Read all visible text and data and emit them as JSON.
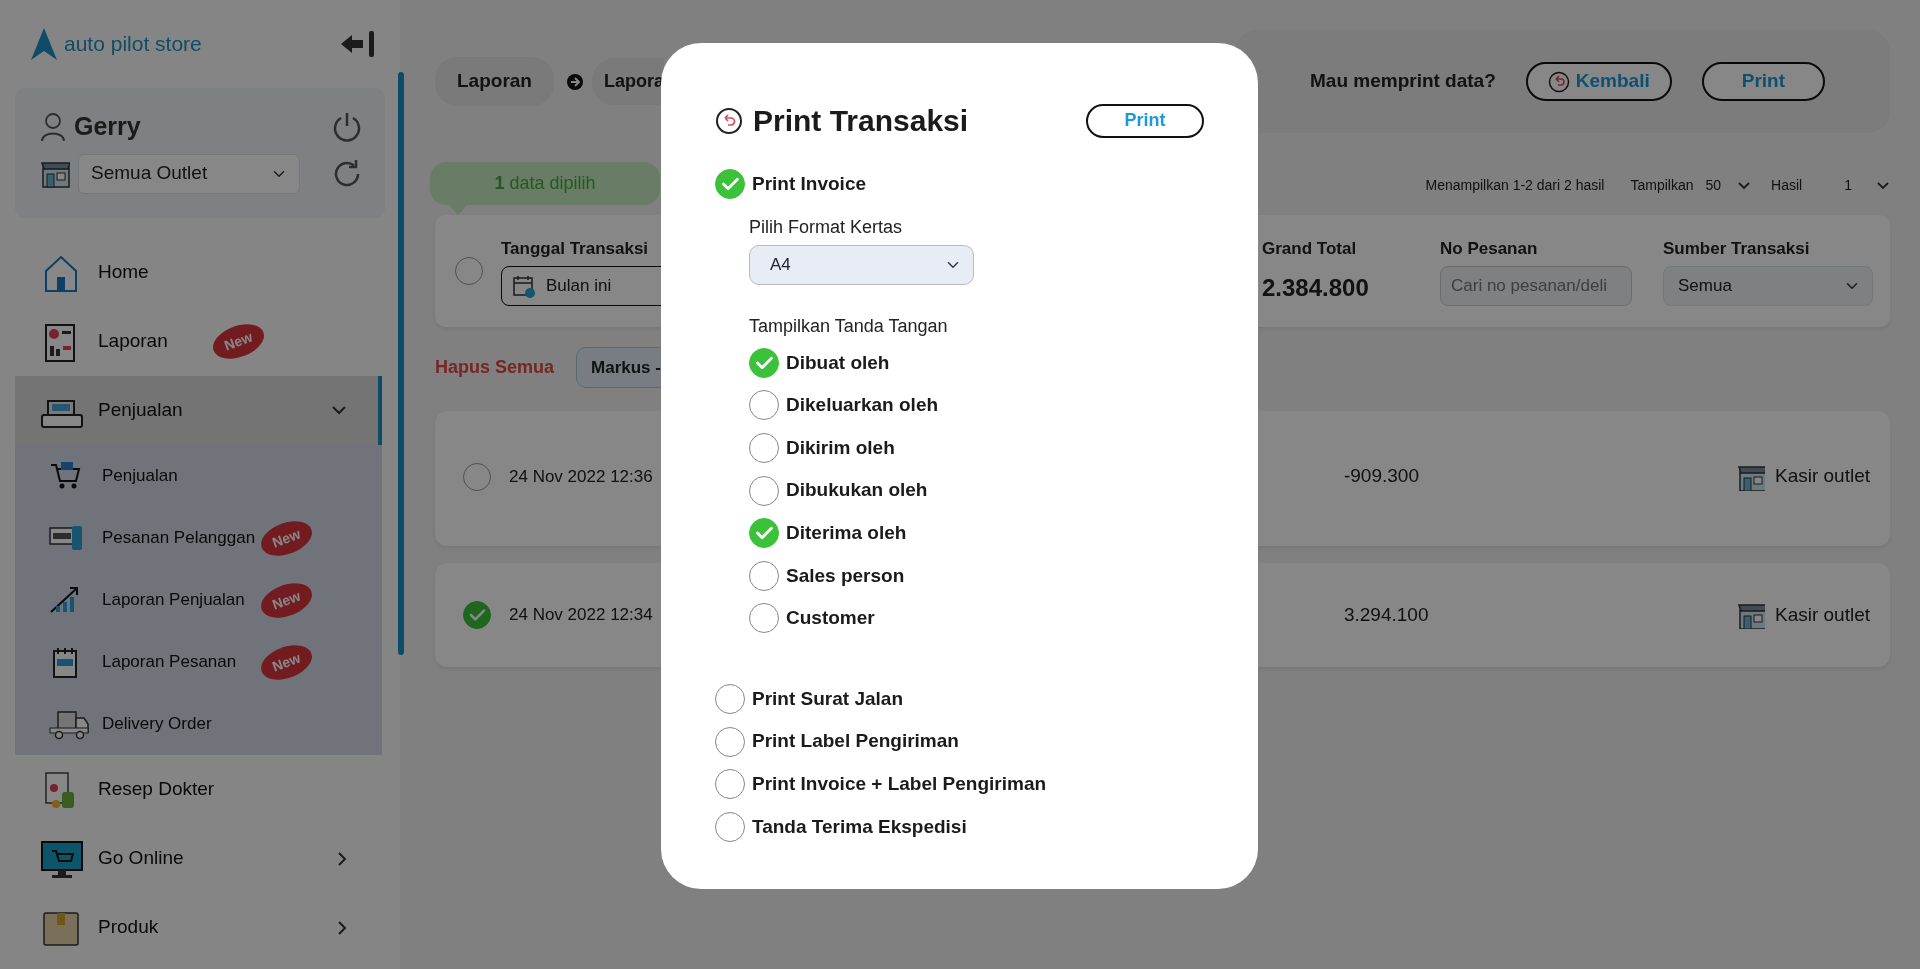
{
  "sidebar": {
    "logo": "auto pilot store",
    "user": {
      "name": "Gerry"
    },
    "outlet_select": {
      "value": "Semua Outlet"
    },
    "menu": [
      {
        "label": "Home",
        "selected": false
      },
      {
        "label": "Laporan",
        "badge": "New",
        "selected": false
      },
      {
        "label": "Penjualan",
        "selected": true,
        "expanded": true,
        "children": [
          {
            "label": "Penjualan"
          },
          {
            "label": "Pesanan Pelanggan",
            "badge": "New"
          },
          {
            "label": "Laporan Penjualan",
            "badge": "New"
          },
          {
            "label": "Laporan Pesanan",
            "badge": "New"
          },
          {
            "label": "Delivery Order"
          }
        ]
      },
      {
        "label": "Resep Dokter",
        "selected": false
      },
      {
        "label": "Go Online",
        "selected": false,
        "expanded": false
      },
      {
        "label": "Produk",
        "selected": false,
        "expanded": false
      }
    ]
  },
  "breadcrumb": [
    "Laporan",
    "Lapora"
  ],
  "confirm_bar": {
    "question": "Mau memprint data?",
    "buttons": [
      {
        "label": "Kembali",
        "kind": "back"
      },
      {
        "label": "Print",
        "kind": "plain"
      }
    ]
  },
  "selection_tooltip": "**1** data dipilih",
  "pagination": {
    "summary": "Menampilkan 1-2 dari 2 hasil",
    "per_page_label": "Tampilkan",
    "per_page": "50",
    "page_label": "Hasil",
    "page": "1"
  },
  "filters": {
    "select_all": {
      "checked": false
    },
    "date": {
      "label": "Tanggal Transaksi",
      "value": "Bulan ini"
    },
    "grand_total": {
      "label": "Grand Total",
      "value": "2.384.800"
    },
    "order_no": {
      "label": "No Pesanan",
      "placeholder": "Cari no pesanan/deli"
    },
    "source": {
      "label": "Sumber Transaksi",
      "value": "Semua"
    }
  },
  "chips": {
    "clear_label": "Hapus Semua",
    "items": [
      "Markus -"
    ]
  },
  "rows": [
    {
      "checked": false,
      "date": "24 Nov 2022 12:36",
      "amount": "-909.300",
      "source": "Kasir outlet"
    },
    {
      "checked": true,
      "date": "24 Nov 2022 12:34",
      "amount": "3.294.100",
      "source": "Kasir outlet"
    }
  ],
  "modal": {
    "title": "Print Transaksi",
    "print_button": "Print",
    "options": [
      {
        "label": "Print Invoice",
        "checked": true,
        "paper_format": {
          "label": "Pilih Format Kertas",
          "value": "A4"
        },
        "signature": {
          "label": "Tampilkan Tanda Tangan",
          "items": [
            {
              "label": "Dibuat oleh",
              "checked": true
            },
            {
              "label": "Dikeluarkan oleh",
              "checked": false
            },
            {
              "label": "Dikirim oleh",
              "checked": false
            },
            {
              "label": "Dibukukan oleh",
              "checked": false
            },
            {
              "label": "Diterima oleh",
              "checked": true
            },
            {
              "label": "Sales person",
              "checked": false
            },
            {
              "label": "Customer",
              "checked": false
            }
          ]
        }
      },
      {
        "label": "Print Surat Jalan",
        "checked": false
      },
      {
        "label": "Print Label Pengiriman",
        "checked": false
      },
      {
        "label": "Print Invoice + Label Pengiriman",
        "checked": false
      },
      {
        "label": "Tanda Terima Ekspedisi",
        "checked": false
      }
    ]
  }
}
